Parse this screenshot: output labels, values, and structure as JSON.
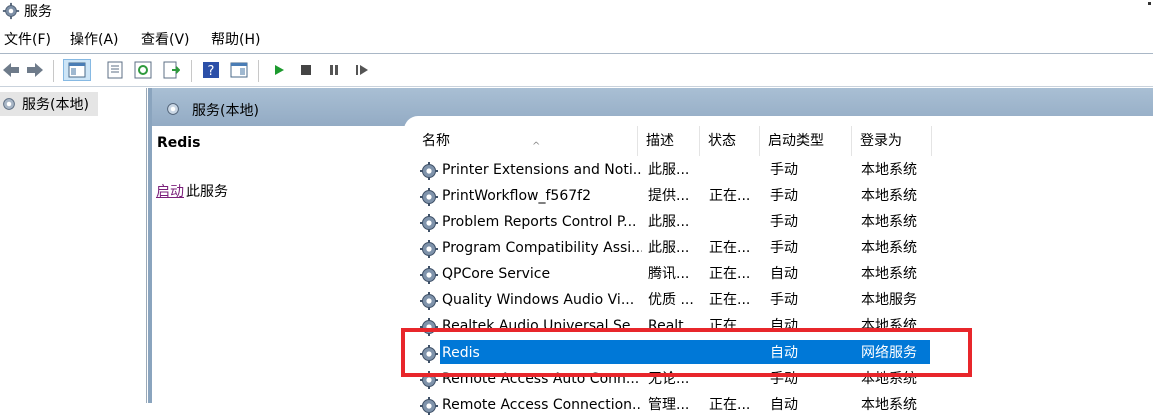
{
  "window": {
    "title": "服务",
    "icon": "services-gear-icon"
  },
  "menu": [
    "文件(F)",
    "操作(A)",
    "查看(V)",
    "帮助(H)"
  ],
  "toolbar": {
    "buttons": [
      "back-arrow-icon",
      "forward-arrow-icon",
      "show-hide-tree-icon",
      "properties-icon",
      "refresh-icon",
      "export-list-icon",
      "help-icon",
      "show-action-pane-icon",
      "start-service-icon",
      "stop-service-icon",
      "pause-service-icon",
      "restart-service-icon"
    ]
  },
  "tree": {
    "selected": "服务(本地)"
  },
  "header": {
    "title": "服务(本地)"
  },
  "detail": {
    "service_name": "Redis",
    "link": "启动",
    "link_suffix": "此服务"
  },
  "columns": [
    "名称",
    "描述",
    "状态",
    "启动类型",
    "登录为"
  ],
  "rows": [
    {
      "name": "Printer Extensions and Noti...",
      "desc": "此服...",
      "status": "",
      "startup": "手动",
      "logon": "本地系统"
    },
    {
      "name": "PrintWorkflow_f567f2",
      "desc": "提供...",
      "status": "正在...",
      "startup": "手动",
      "logon": "本地系统"
    },
    {
      "name": "Problem Reports Control P...",
      "desc": "此服...",
      "status": "",
      "startup": "手动",
      "logon": "本地系统"
    },
    {
      "name": "Program Compatibility Assi...",
      "desc": "此服...",
      "status": "正在...",
      "startup": "手动",
      "logon": "本地系统"
    },
    {
      "name": "QPCore Service",
      "desc": "腾讯...",
      "status": "正在...",
      "startup": "自动",
      "logon": "本地系统"
    },
    {
      "name": "Quality Windows Audio Vi...",
      "desc": "优质 ...",
      "status": "正在...",
      "startup": "手动",
      "logon": "本地服务"
    },
    {
      "name": "Realtek Audio Universal Se...",
      "desc": "Realt...",
      "status": "正在...",
      "startup": "自动",
      "logon": "本地系统"
    },
    {
      "name": "Redis",
      "desc": "",
      "status": "",
      "startup": "自动",
      "logon": "网络服务",
      "selected": true
    },
    {
      "name": "Remote Access Auto Conn...",
      "desc": "无论...",
      "status": "",
      "startup": "手动",
      "logon": "本地系统"
    },
    {
      "name": "Remote Access Connection...",
      "desc": "管理...",
      "status": "正在...",
      "startup": "自动",
      "logon": "本地系统"
    }
  ],
  "colors": {
    "selection": "#0078d7",
    "highlight_box": "#e8262b",
    "header_bg": "#a9bfd4",
    "link": "#7a1f7a"
  }
}
